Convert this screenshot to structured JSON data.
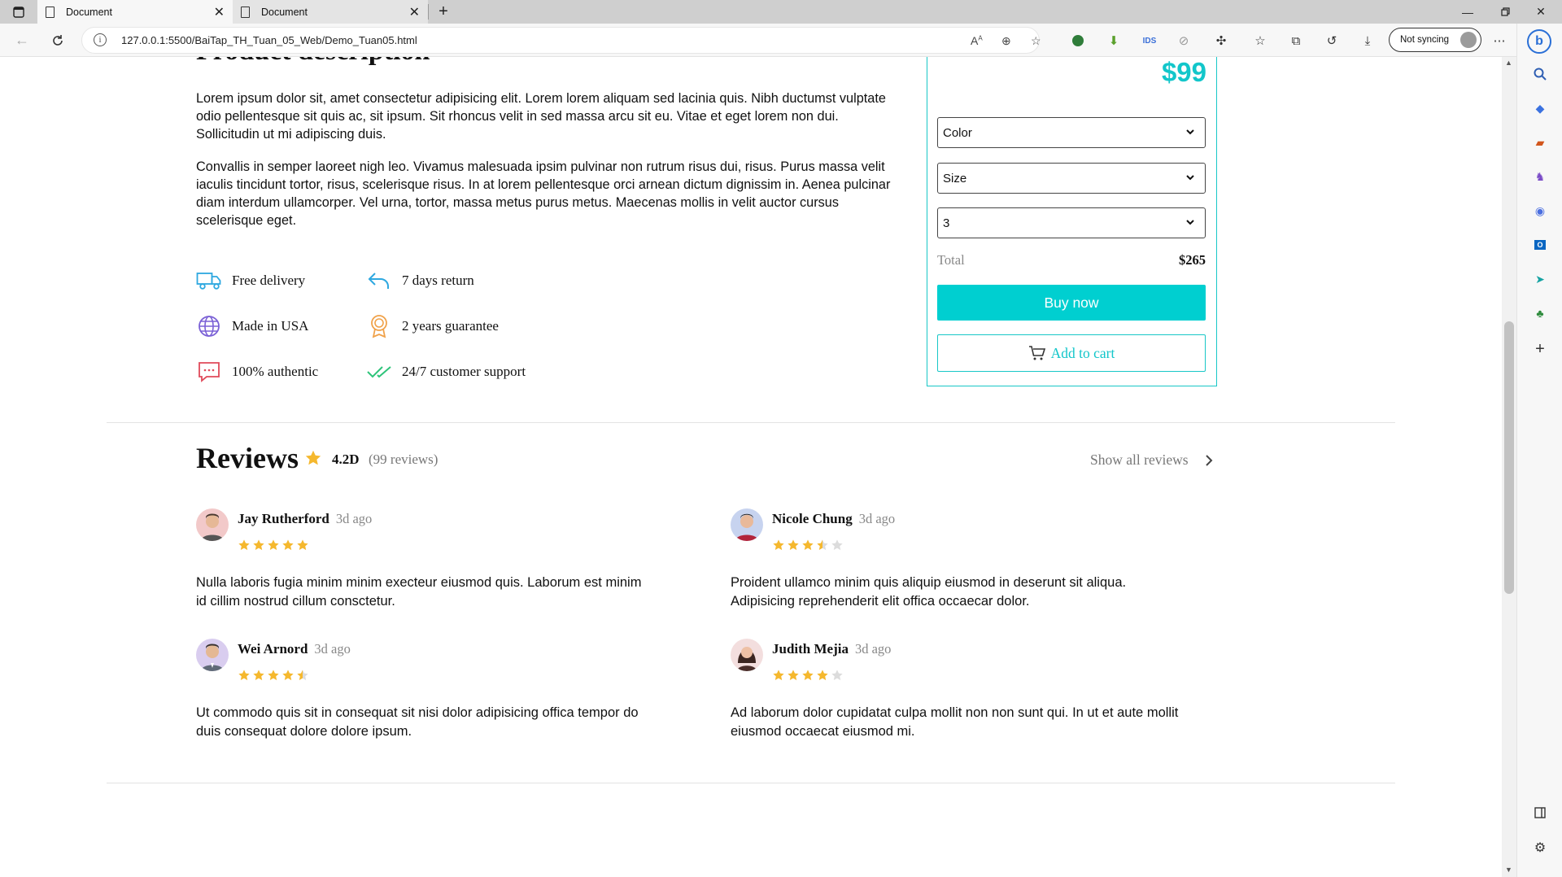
{
  "browser": {
    "tabs": [
      {
        "title": "Document",
        "active": true
      },
      {
        "title": "Document",
        "active": false
      }
    ],
    "url": "127.0.0.1:5500/BaiTap_TH_Tuan_05_Web/Demo_Tuan05.html",
    "sync_label": "Not syncing"
  },
  "description": {
    "title": "Product description",
    "paragraphs": [
      "Lorem ipsum dolor sit, amet consectetur adipisicing elit. Lorem lorem aliquam sed lacinia quis. Nibh ductumst vulptate odio pellentesque sit quis ac, sit ipsum. Sit rhoncus velit in sed massa arcu sit eu. Vitae et eget lorem non dui. Sollicitudin ut mi adipiscing duis.",
      "Convallis in semper laoreet nigh leo. Vivamus malesuada ipsim pulvinar non rutrum risus dui, risus. Purus massa velit iaculis tincidunt tortor, risus, scelerisque risus. In at lorem pellentesque orci arnean dictum dignissim in. Aenea pulcinar diam interdum ullamcorper. Vel urna, tortor, massa metus purus metus. Maecenas mollis in velit auctor cursus scelerisque eget."
    ]
  },
  "features": [
    {
      "label": "Free delivery",
      "icon": "truck-icon",
      "color": "#2ea8e0"
    },
    {
      "label": "7 days return",
      "icon": "return-arrow-icon",
      "color": "#2ea8e0"
    },
    {
      "label": "Made in USA",
      "icon": "globe-icon",
      "color": "#7b61d6"
    },
    {
      "label": "2 years guarantee",
      "icon": "award-icon",
      "color": "#f0a24a"
    },
    {
      "label": "100% authentic",
      "icon": "message-icon",
      "color": "#e04a5a"
    },
    {
      "label": "24/7 customer support",
      "icon": "double-check-icon",
      "color": "#2ec47a"
    }
  ],
  "buybox": {
    "price": "$99",
    "color_select": "Color",
    "size_select": "Size",
    "quantity_select": "3",
    "total_label": "Total",
    "total_value": "$265",
    "buy_label": "Buy now",
    "cart_label": "Add to cart",
    "accent_color": "#00cfd0"
  },
  "reviews": {
    "title": "Reviews",
    "score": "4.2D",
    "count": "(99 reviews)",
    "show_all": "Show all reviews",
    "items": [
      {
        "name": "Jay Rutherford",
        "ago": "3d ago",
        "rating": 5,
        "text": "Nulla laboris fugia minim minim execteur eiusmod quis. Laborum est minim id cillim nostrud cillum consctetur."
      },
      {
        "name": "Nicole Chung",
        "ago": "3d ago",
        "rating": 3.5,
        "text": "Proident ullamco minim quis aliquip eiusmod in deserunt sit aliqua. Adipisicing reprehenderit elit offica occaecar dolor."
      },
      {
        "name": "Wei Arnord",
        "ago": "3d ago",
        "rating": 4.5,
        "text": "Ut commodo quis sit in consequat sit nisi dolor adipisicing offica tempor do duis consequat dolore dolore ipsum."
      },
      {
        "name": "Judith Mejia",
        "ago": "3d ago",
        "rating": 4,
        "text": "Ad laborum dolor cupidatat culpa mollit non non sunt qui. In ut et aute mollit eiusmod occaecat eiusmod mi."
      }
    ]
  }
}
